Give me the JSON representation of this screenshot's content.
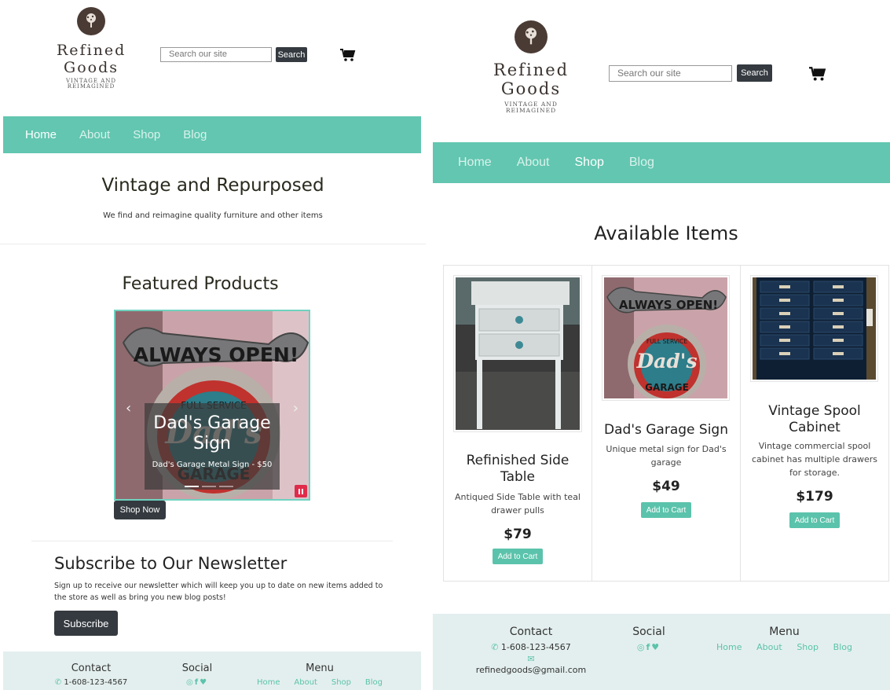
{
  "brand": {
    "name_line1": "Refined",
    "name_line2": "Goods",
    "tagline_line1": "VINTAGE AND",
    "tagline_line2": "REIMAGINED"
  },
  "search": {
    "placeholder": "Search our site",
    "button_label": "Search"
  },
  "nav": {
    "items": [
      "Home",
      "About",
      "Shop",
      "Blog"
    ]
  },
  "home": {
    "hero_title": "Vintage and Repurposed",
    "hero_subtitle": "We find and reimagine quality furniture and other items",
    "featured_title": "Featured Products",
    "carousel": {
      "slide_title_line1": "Dad's Garage",
      "slide_title_line2": "Sign",
      "slide_subtitle": "Dad's Garage Metal Sign - $50",
      "sign_top_text": "ALWAYS OPEN!",
      "sign_ring_text": "FULL SERVICE",
      "sign_center_text": "Dad's",
      "sign_bottom_text": "GARAGE"
    },
    "shop_now_label": "Shop Now",
    "newsletter_title": "Subscribe to Our Newsletter",
    "newsletter_text_line1": "Sign up to receive our newsletter which will keep you up to date on new items added to",
    "newsletter_text_line2": "the store as well as bring you new blog posts!",
    "subscribe_label": "Subscribe"
  },
  "shop": {
    "title": "Available Items",
    "products": [
      {
        "title_line1": "Refinished Side",
        "title_line2": "Table",
        "desc_line1": "Antiqued Side Table with teal",
        "desc_line2": "drawer pulls",
        "price": "$79"
      },
      {
        "title_line1": "Dad's Garage Sign",
        "title_line2": "",
        "desc_line1": "Unique metal sign for Dad's",
        "desc_line2": "garage",
        "price": "$49"
      },
      {
        "title_line1": "Vintage Spool",
        "title_line2": "Cabinet",
        "desc_line1": "Vintage commercial spool",
        "desc_line2": "cabinet has multiple drawers",
        "desc_line3": "for storage.",
        "price": "$179"
      }
    ],
    "add_to_cart_label": "Add to Cart"
  },
  "footer": {
    "contact_heading": "Contact",
    "phone": "1-608-123-4567",
    "email": "refinedgoods@gmail.com",
    "social_heading": "Social",
    "menu_heading": "Menu",
    "menu_items": [
      "Home",
      "About",
      "Shop",
      "Blog"
    ]
  },
  "colors": {
    "accent": "#62c6b0",
    "dark_button": "#343a40",
    "footer_bg": "#e3efee",
    "link": "#5bc3ab"
  }
}
